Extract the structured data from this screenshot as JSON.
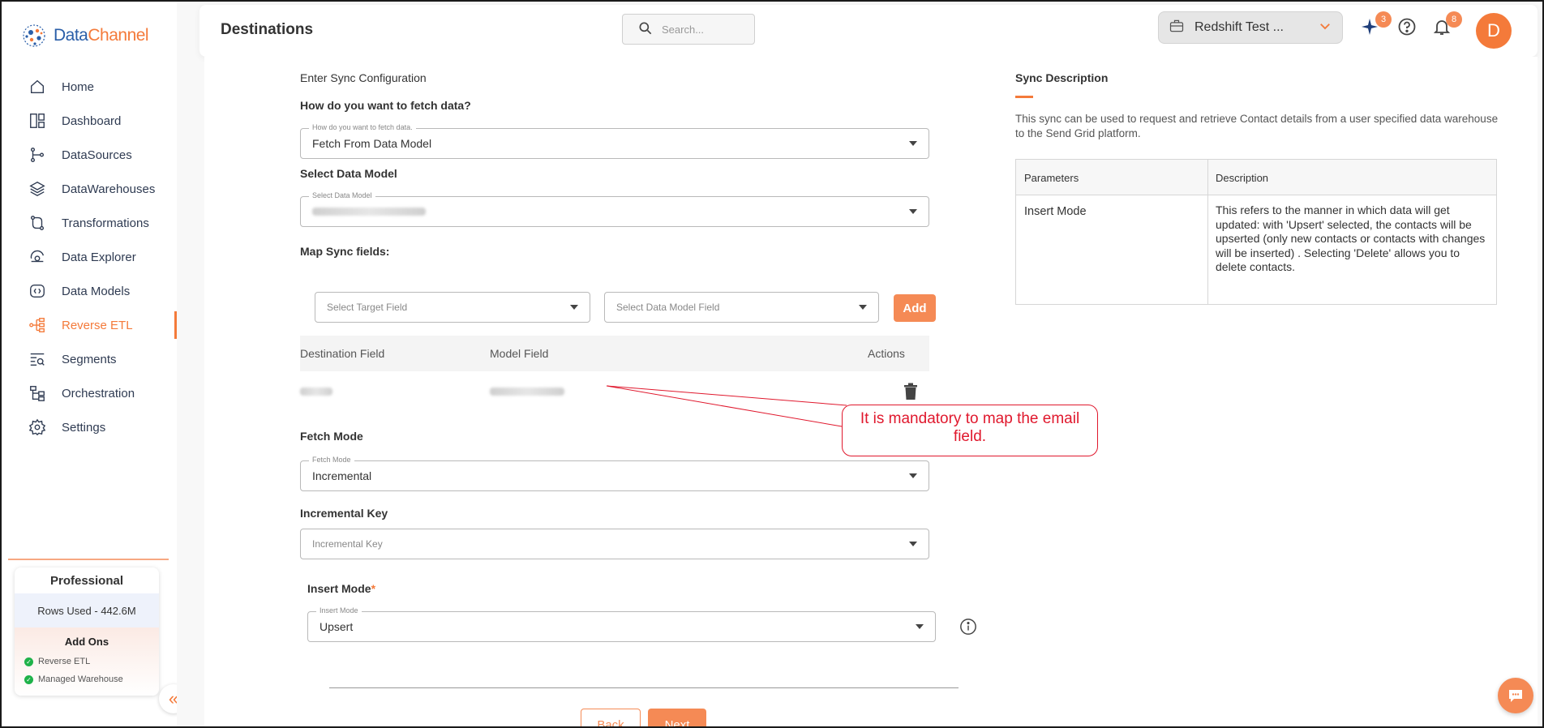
{
  "brand": {
    "name_part1": "Data",
    "name_part2": "Channel"
  },
  "sidebar": {
    "items": [
      {
        "label": "Home",
        "icon": "home-icon"
      },
      {
        "label": "Dashboard",
        "icon": "dashboard-icon"
      },
      {
        "label": "DataSources",
        "icon": "datasources-icon"
      },
      {
        "label": "DataWarehouses",
        "icon": "datawarehouses-icon"
      },
      {
        "label": "Transformations",
        "icon": "transformations-icon"
      },
      {
        "label": "Data Explorer",
        "icon": "data-explorer-icon"
      },
      {
        "label": "Data Models",
        "icon": "data-models-icon"
      },
      {
        "label": "Reverse ETL",
        "icon": "reverse-etl-icon",
        "active": true
      },
      {
        "label": "Segments",
        "icon": "segments-icon"
      },
      {
        "label": "Orchestration",
        "icon": "orchestration-icon"
      },
      {
        "label": "Settings",
        "icon": "settings-icon"
      }
    ],
    "plan": {
      "title": "Professional",
      "rows_used": "Rows Used - 442.6M",
      "addons_title": "Add Ons",
      "addons": [
        "Reverse ETL",
        "Managed Warehouse"
      ]
    }
  },
  "header": {
    "title": "Destinations",
    "search_placeholder": "Search...",
    "workspace": "Redshift Test ...",
    "sparkle_badge": "3",
    "notification_badge": "8",
    "avatar_initial": "D"
  },
  "form": {
    "section_title": "Enter Sync Configuration",
    "fetch_question": "How do you want to fetch data?",
    "fetch_float": "How do you want to fetch data.",
    "fetch_value": "Fetch From Data Model",
    "data_model_label": "Select Data Model",
    "data_model_float": "Select Data Model",
    "map_label": "Map Sync fields:",
    "target_placeholder": "Select Target Field",
    "model_field_placeholder": "Select Data Model Field",
    "add_label": "Add",
    "table_headers": [
      "Destination Field",
      "Model Field",
      "Actions"
    ],
    "fetch_mode_label": "Fetch Mode",
    "fetch_mode_float": "Fetch Mode",
    "fetch_mode_value": "Incremental",
    "incremental_key_label": "Incremental Key",
    "incremental_key_placeholder": "Incremental Key",
    "insert_mode_label": "Insert Mode",
    "insert_mode_required": "*",
    "insert_mode_float": "Insert Mode",
    "insert_mode_value": "Upsert",
    "back_label": "Back",
    "next_label": "Next"
  },
  "callout": {
    "line1": "It is mandatory to map the email",
    "line2": "field."
  },
  "description": {
    "title": "Sync Description",
    "text": "This sync can be used to request and retrieve Contact details from a user specified data warehouse to the Send Grid platform.",
    "headers": [
      "Parameters",
      "Description"
    ],
    "rows": [
      {
        "param": "Insert Mode",
        "desc": "This refers to the manner in which data will get updated: with 'Upsert' selected, the contacts will be upserted (only new contacts or contacts with changes will be inserted) . Selecting 'Delete' allows you to delete contacts."
      }
    ]
  },
  "colors": {
    "accent": "#f47a3a",
    "button": "#f58a55",
    "annotation": "#e0182d"
  }
}
